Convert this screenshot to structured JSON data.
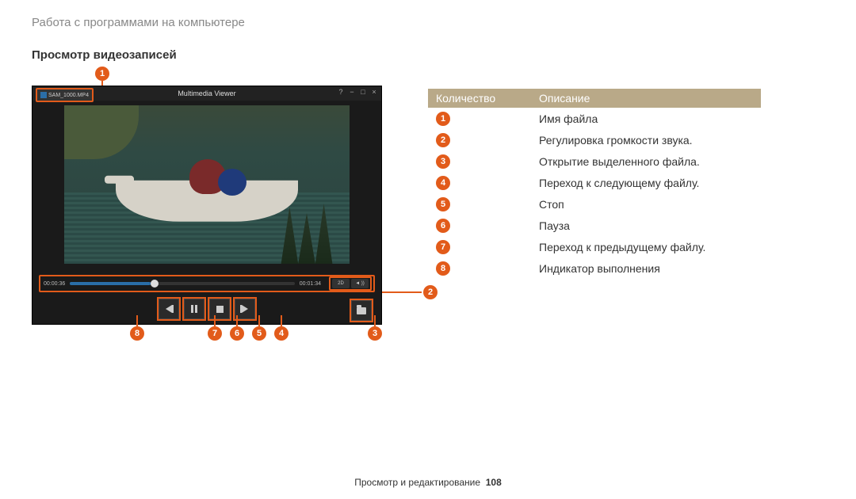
{
  "breadcrumb": "Работа с программами на компьютере",
  "section_title": "Просмотр видеозаписей",
  "player": {
    "app_title": "Multimedia Viewer",
    "file_label": "SAM_1000.MP4",
    "time_elapsed": "00:00:36",
    "time_total": "00:01:34",
    "vol_mode": "2D",
    "vol_level": "◄ ))"
  },
  "callouts_left": {
    "top": "1",
    "right": "2",
    "bottom": [
      "8",
      "7",
      "6",
      "5",
      "4",
      "3"
    ]
  },
  "table": {
    "headers": {
      "qty": "Количество",
      "desc": "Описание"
    },
    "rows": [
      {
        "n": "1",
        "d": "Имя файла"
      },
      {
        "n": "2",
        "d": "Регулировка громкости звука."
      },
      {
        "n": "3",
        "d": "Открытие выделенного файла."
      },
      {
        "n": "4",
        "d": "Переход к следующему файлу."
      },
      {
        "n": "5",
        "d": "Стоп"
      },
      {
        "n": "6",
        "d": "Пауза"
      },
      {
        "n": "7",
        "d": "Переход к предыдущему файлу."
      },
      {
        "n": "8",
        "d": "Индикатор выполнения"
      }
    ]
  },
  "footer": {
    "section": "Просмотр и редактирование",
    "page": "108"
  }
}
